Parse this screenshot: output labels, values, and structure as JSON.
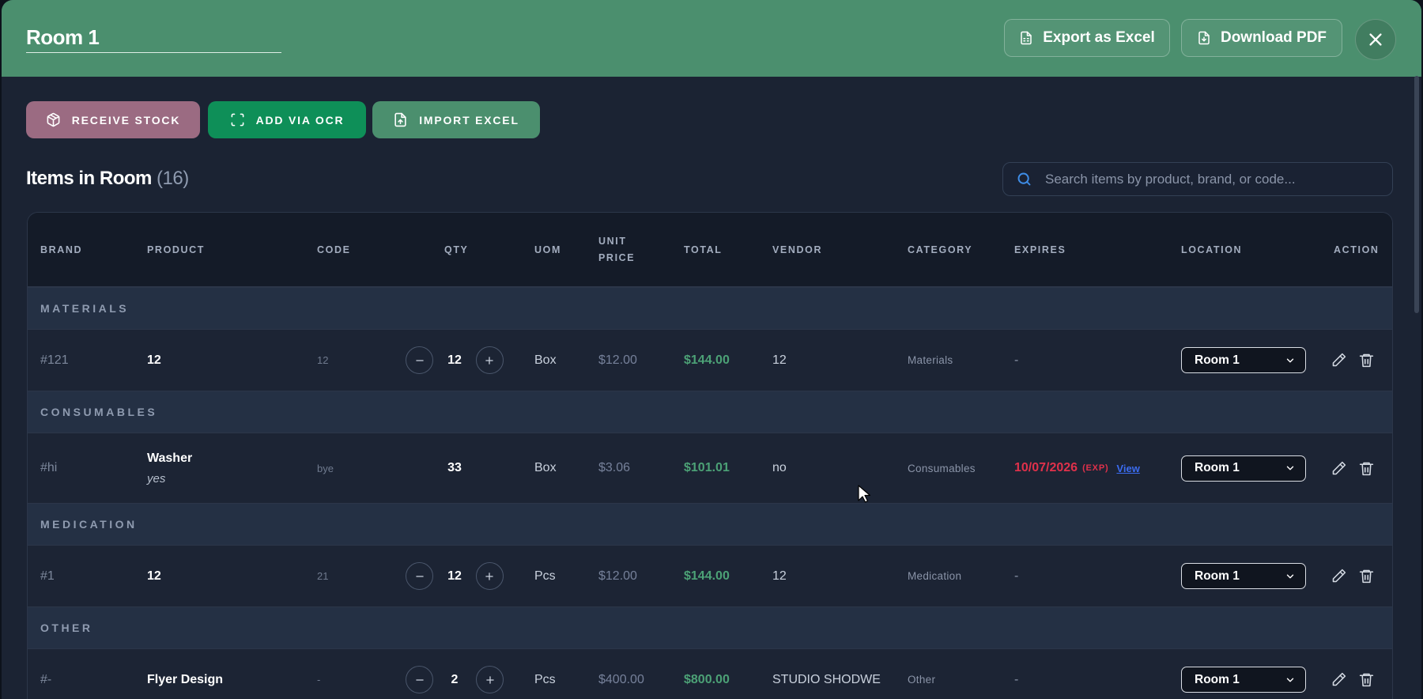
{
  "header": {
    "title": "Room 1",
    "export_excel": "Export as Excel",
    "download_pdf": "Download PDF"
  },
  "actions": {
    "receive_stock": "RECEIVE STOCK",
    "add_via_ocr": "ADD VIA OCR",
    "import_excel": "IMPORT EXCEL"
  },
  "section": {
    "title": "Items in Room",
    "count": "(16)"
  },
  "search": {
    "placeholder": "Search items by product, brand, or code..."
  },
  "columns": {
    "brand": "BRAND",
    "product": "PRODUCT",
    "code": "CODE",
    "qty": "QTY",
    "uom": "UOM",
    "unit_price_1": "UNIT",
    "unit_price_2": "PRICE",
    "total": "TOTAL",
    "vendor": "VENDOR",
    "category": "CATEGORY",
    "expires": "EXPIRES",
    "location": "LOCATION",
    "action": "ACTION"
  },
  "groups": {
    "materials": "MATERIALS",
    "consumables": "CONSUMABLES",
    "medication": "MEDICATION",
    "other": "OTHER"
  },
  "rows": [
    {
      "brand": "#121",
      "product": "12",
      "code": "12",
      "qty": "12",
      "uom": "Box",
      "unit_price": "$12.00",
      "total": "$144.00",
      "vendor": "12",
      "category": "Materials",
      "expires": "-",
      "location": "Room 1"
    },
    {
      "brand": "#hi",
      "product": "Washer",
      "product_note": "yes",
      "code": "bye",
      "qty": "33",
      "uom": "Box",
      "unit_price": "$3.06",
      "total": "$101.01",
      "vendor": "no",
      "category": "Consumables",
      "expires": "10/07/2026",
      "expires_tag": "(EXP)",
      "expires_link": "View",
      "location": "Room 1"
    },
    {
      "brand": "#1",
      "product": "12",
      "code": "21",
      "qty": "12",
      "uom": "Pcs",
      "unit_price": "$12.00",
      "total": "$144.00",
      "vendor": "12",
      "category": "Medication",
      "expires": "-",
      "location": "Room 1"
    },
    {
      "brand": "#-",
      "product": "Flyer Design",
      "code": "-",
      "qty": "2",
      "uom": "Pcs",
      "unit_price": "$400.00",
      "total": "$800.00",
      "vendor": "STUDIO SHODWE",
      "category": "Other",
      "expires": "-",
      "location": "Room 1"
    }
  ],
  "colors": {
    "header_bg": "#4b8f6e",
    "receive_bg": "#9b6b82",
    "ocr_bg": "#0e8f58",
    "import_bg": "#4b8f6e",
    "total_text": "#4ca176",
    "expired_text": "#e0314b",
    "link_text": "#3b6cf0"
  },
  "icons": {
    "export_excel": "file-spreadsheet-icon",
    "download_pdf": "file-download-icon",
    "close": "close-icon",
    "receive": "package-icon",
    "ocr": "scan-icon",
    "import": "file-upload-icon",
    "search": "search-icon",
    "edit": "pencil-icon",
    "delete": "trash-icon",
    "dropdown": "chevron-down-icon"
  }
}
